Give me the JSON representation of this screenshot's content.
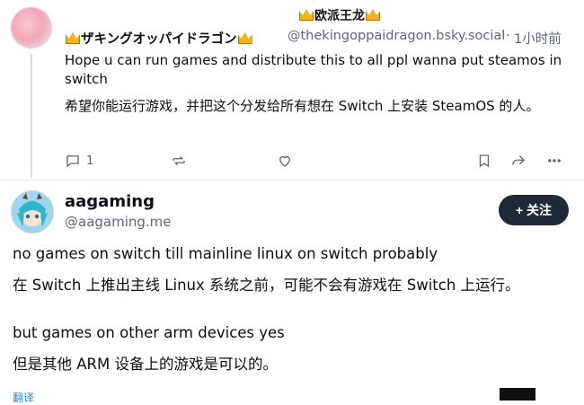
{
  "overlay": {
    "title": "欧派王龙"
  },
  "reply": {
    "author": "ザキングオッパイドラゴン",
    "handle": "@thekingoppaidragon.bsky.social",
    "separator": "·",
    "time": "1小时前",
    "text_en": "Hope u can run games and distribute this to all ppl wanna put steamos in switch",
    "text_zh": "希望你能运行游戏，并把这个分发给所有想在 Switch 上安装 SteamOS 的人。",
    "reply_count": "1"
  },
  "post": {
    "author": "aagaming",
    "handle": "@aagaming.me",
    "follow_label": "+ 关注",
    "lines": [
      "no games on switch till mainline linux on switch probably",
      "在 Switch 上推出主线 Linux 系统之前，可能不会有游戏在 Switch 上运行。",
      "but games on other arm devices yes",
      "但是其他 ARM 设备上的游戏是可以的。"
    ],
    "translate_label": "翻译"
  },
  "icons": {
    "reply": "reply-icon",
    "repost": "repost-icon",
    "like": "heart-icon",
    "bookmark": "bookmark-icon",
    "share": "share-icon",
    "more": "more-icon",
    "crown": "crown-icon"
  },
  "colors": {
    "accent": "#1d8cf8",
    "follow_bg": "#1f2937",
    "muted": "#5a6876",
    "crown": "#f2b21b"
  }
}
